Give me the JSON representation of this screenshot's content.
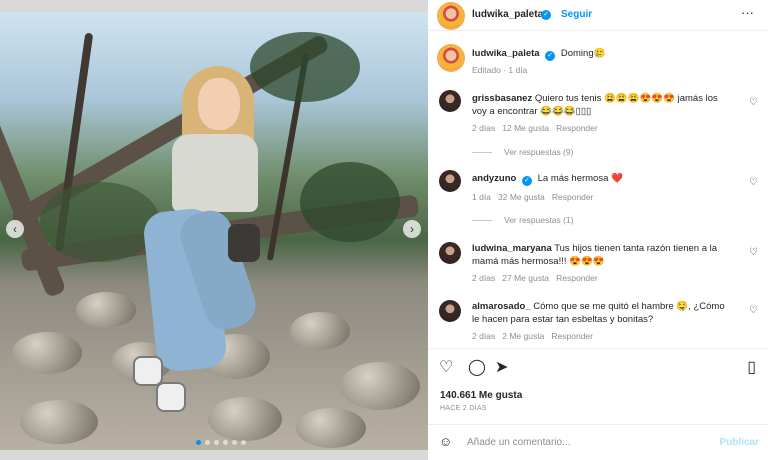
{
  "post": {
    "author": "ludwika_paleta",
    "follow_label": "Seguir",
    "caption_text": "Doming",
    "caption_emoji": "🥲",
    "caption_meta": "Editado · 1 día"
  },
  "comments": [
    {
      "user": "grissbasanez",
      "text": "Quiero tus tenis 😩😩😩😍😍😍 jamás los voy a encontrar 😂😂😂▯▯▯",
      "meta": [
        "2 días",
        "12 Me gusta",
        "Responder"
      ],
      "replies": "Ver respuestas (9)"
    },
    {
      "user": "andyzuno",
      "text": "La más hermosa ❤️",
      "meta": [
        "1 día",
        "32 Me gusta",
        "Responder"
      ],
      "replies": "Ver respuestas (1)"
    },
    {
      "user": "ludwina_maryana",
      "text": "Tus hijos tienen tanta razón tienen a la mamá más hermosa!!! 😍😍😍",
      "meta": [
        "2 días",
        "27 Me gusta",
        "Responder"
      ]
    },
    {
      "user": "almarosado_",
      "text": "Cómo que se me quitó el hambre 🤤, ¿Cómo le hacen para estar tan esbeltas y bonitas?",
      "meta": [
        "2 días",
        "2 Me gusta",
        "Responder"
      ]
    }
  ],
  "stats": {
    "likes": "140.661 Me gusta",
    "age": "HACE 2 DÍAS"
  },
  "composer": {
    "placeholder": "Añade un comentario...",
    "publish": "Publicar"
  }
}
